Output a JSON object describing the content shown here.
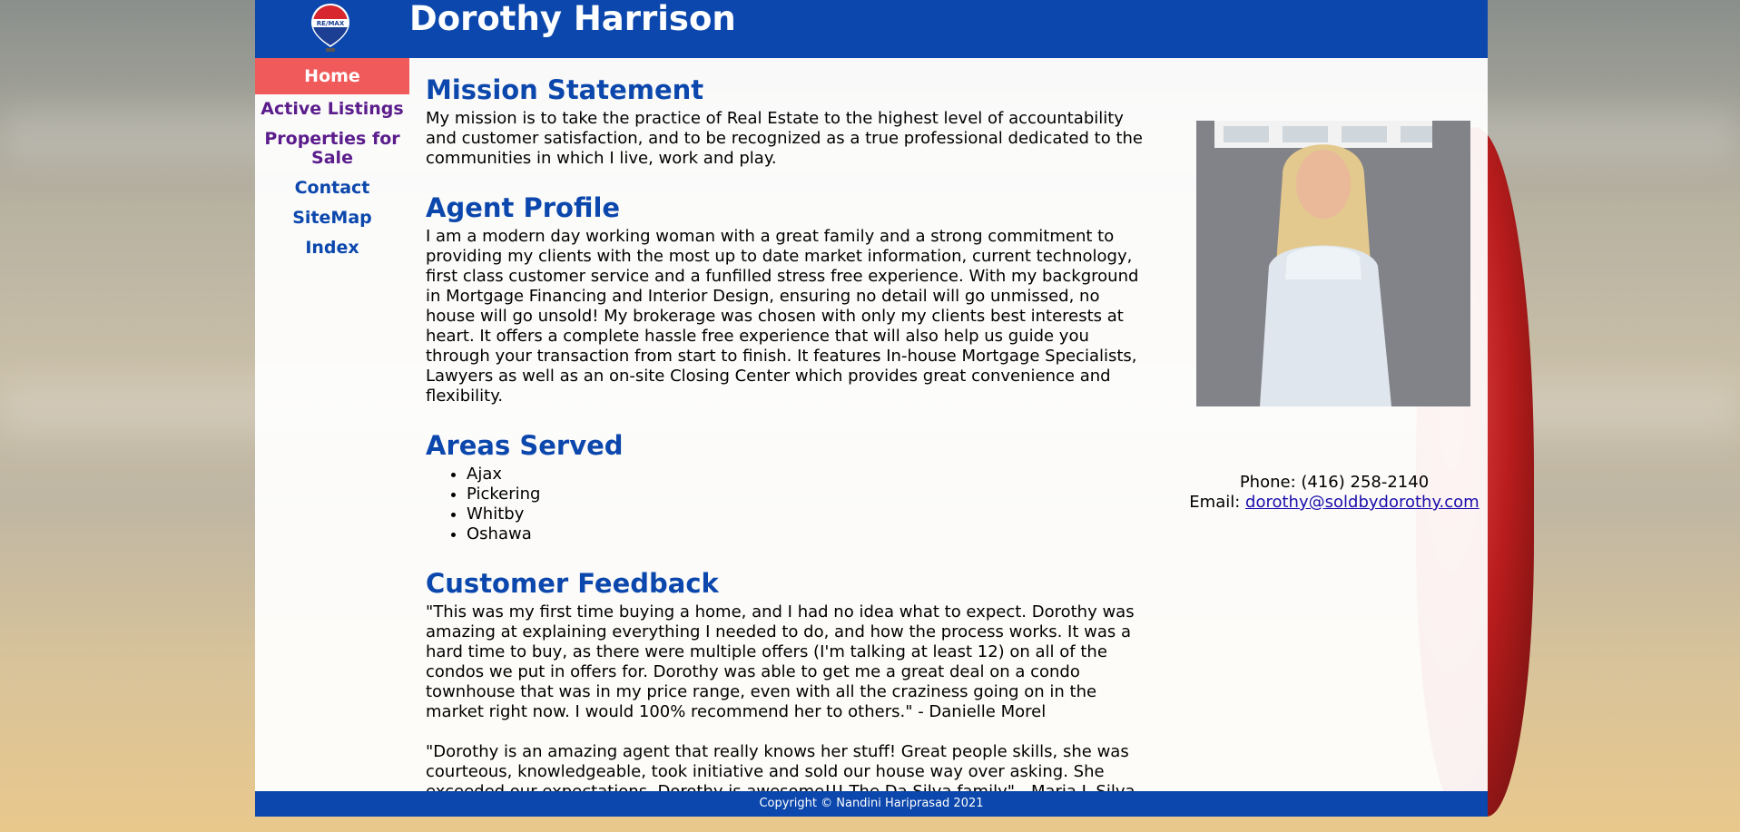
{
  "header": {
    "logo_text": "RE/MAX",
    "title": "Dorothy Harrison"
  },
  "nav": {
    "items": [
      {
        "label": "Home"
      },
      {
        "label": "Active Listings"
      },
      {
        "label": "Properties for Sale"
      },
      {
        "label": "Contact"
      },
      {
        "label": "SiteMap"
      },
      {
        "label": "Index"
      }
    ]
  },
  "main": {
    "mission": {
      "heading": "Mission Statement",
      "text": "My mission is to take the practice of Real Estate to the highest level of accountability and customer satisfaction, and to be recognized as a true professional dedicated to the communities in which I live, work and play."
    },
    "profile": {
      "heading": "Agent Profile",
      "text": "I am a modern day working woman with a great family and a strong commitment to providing my clients with the most up to date market information, current technology, first class customer service and a funfilled stress free experience. With my background in Mortgage Financing and Interior Design, ensuring no detail will go unmissed, no house will go unsold! My brokerage was chosen with only my clients best interests at heart. It offers a complete hassle free experience that will also help us guide you through your transaction from start to finish. It features In-house Mortgage Specialists, Lawyers as well as an on-site Closing Center which provides great convenience and flexibility."
    },
    "areas": {
      "heading": "Areas Served",
      "items": [
        "Ajax",
        "Pickering",
        "Whitby",
        "Oshawa"
      ]
    },
    "feedback": {
      "heading": "Customer Feedback",
      "quotes": [
        "\"This was my first time buying a home, and I had no idea what to expect. Dorothy was amazing at explaining everything I needed to do, and how the process works. It was a hard time to buy, as there were multiple offers (I'm talking at least 12) on all of the condos we put in offers for. Dorothy was able to get me a great deal on a condo townhouse that was in my price range, even with all the craziness going on in the market right now. I would 100% recommend her to others.\" - Danielle Morel",
        "\"Dorothy is an amazing agent that really knows her stuff! Great people skills, she was courteous, knowledgeable, took initiative and sold our house way over asking. She exceeded our expectations. Dorothy is awesome!!! The Da Silva family\" - Maria L Silva"
      ]
    }
  },
  "contact": {
    "phone_line": "Phone: (416) 258-2140",
    "email_label": "Email:",
    "email": "dorothy@soldbydorothy.com"
  },
  "footer": {
    "text": "Copyright © Nandini Hariprasad 2021"
  },
  "colors": {
    "brand_blue": "#0b47ac",
    "active_nav": "#f05a5a",
    "visited_link": "#5b1d8c"
  }
}
